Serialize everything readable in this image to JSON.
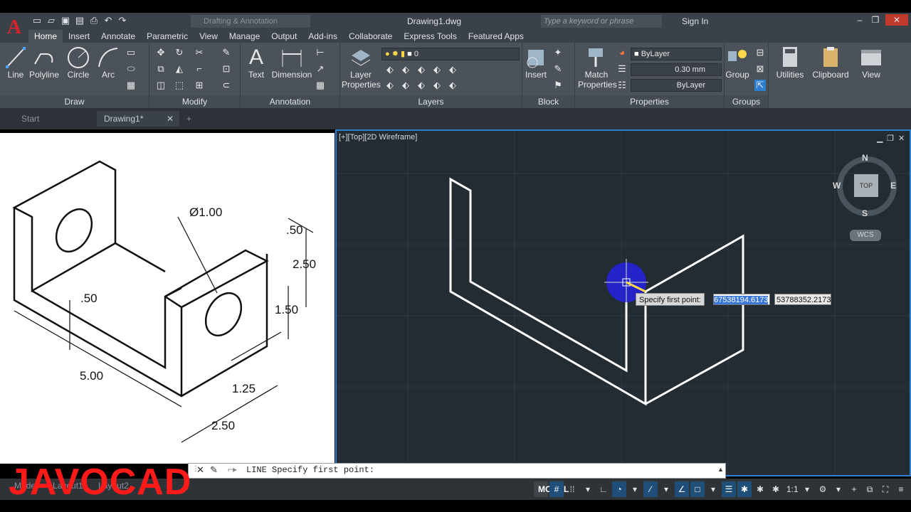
{
  "app": {
    "logo": "A",
    "document_title": "Drawing1.dwg",
    "workspace": "Drafting & Annotation",
    "search_placeholder": "Type a keyword or phrase",
    "sign_in": "Sign In"
  },
  "ribbon_tabs": [
    "Home",
    "Insert",
    "Annotate",
    "Parametric",
    "View",
    "Manage",
    "Output",
    "Add-ins",
    "Collaborate",
    "Express Tools",
    "Featured Apps"
  ],
  "panels": {
    "draw": {
      "title": "Draw",
      "tools": [
        "Line",
        "Polyline",
        "Circle",
        "Arc"
      ]
    },
    "modify": {
      "title": "Modify"
    },
    "annotation": {
      "title": "Annotation",
      "tools": [
        "Text",
        "Dimension"
      ]
    },
    "layers": {
      "title": "Layers",
      "tool": "Layer Properties",
      "current_layer": "0"
    },
    "block": {
      "title": "Block",
      "tool": "Insert"
    },
    "properties": {
      "title": "Properties",
      "tool": "Match Properties",
      "color": "ByLayer",
      "lineweight": "0.30 mm",
      "linetype": "ByLayer"
    },
    "groups": {
      "title": "Groups",
      "tool": "Group"
    },
    "utilities": {
      "label": "Utilities"
    },
    "clipboard": {
      "label": "Clipboard"
    },
    "view": {
      "label": "View"
    }
  },
  "doc_tabs": [
    "Start",
    "Drawing1*"
  ],
  "viewport": {
    "label": "[+][Top][2D Wireframe]",
    "viewcube": {
      "top": "TOP",
      "n": "N",
      "s": "S",
      "e": "E",
      "w": "W",
      "wcs": "WCS"
    },
    "tooltip": "Specify first point:",
    "coord_x": "67538194.6173",
    "coord_y": "53788352.2173"
  },
  "reference_dims": {
    "hole": "Ø1.00",
    "d1": ".50",
    "d2": "2.50",
    "d3": "1.50",
    "d4": ".50",
    "d5": "5.00",
    "d6": "1.25",
    "d7": "2.50"
  },
  "command_line": {
    "text": "LINE Specify first point:"
  },
  "status": {
    "model": "MODEL",
    "scale": "1:1"
  },
  "layout_tabs": [
    "Model",
    "Layout1",
    "Layout2"
  ],
  "watermark": "JAVOCAD",
  "colors": {
    "viewport_bg": "#232b33",
    "ribbon_bg": "#4c5259",
    "accent": "#2f7fd0",
    "watermark": "#ff1a1a"
  }
}
